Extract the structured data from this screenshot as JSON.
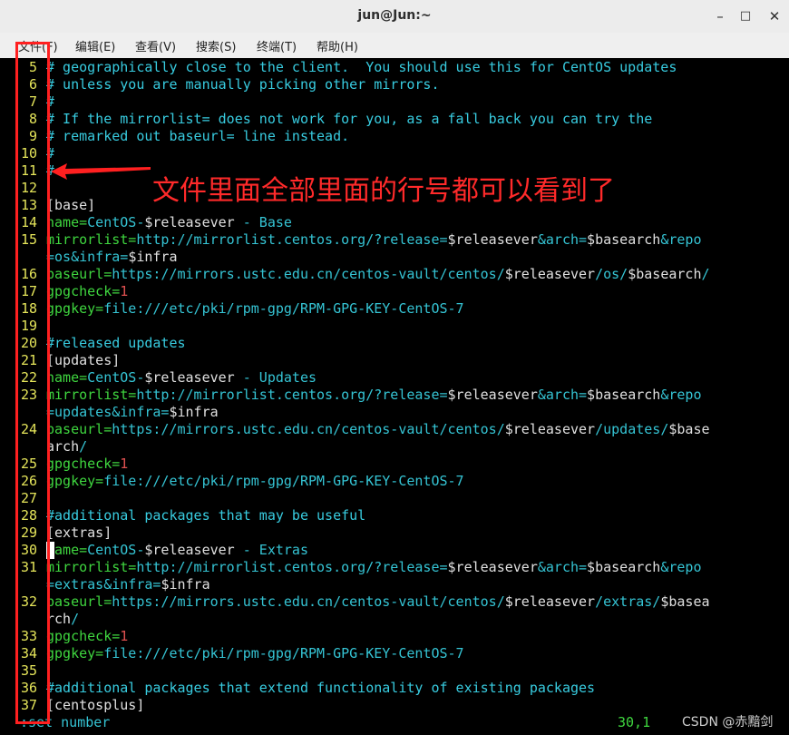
{
  "window": {
    "title": "jun@Jun:~",
    "minimize": "–",
    "maximize": "□",
    "close": "✕"
  },
  "menu": [
    "文件(F)",
    "编辑(E)",
    "查看(V)",
    "搜索(S)",
    "终端(T)",
    "帮助(H)"
  ],
  "lines": [
    {
      "n": "5",
      "parts": [
        [
          "c-com",
          "# geographically close to the client.  You should use this for CentOS updates"
        ]
      ]
    },
    {
      "n": "6",
      "parts": [
        [
          "c-com",
          "# unless you are manually picking other mirrors."
        ]
      ]
    },
    {
      "n": "7",
      "parts": [
        [
          "c-com",
          "#"
        ]
      ]
    },
    {
      "n": "8",
      "parts": [
        [
          "c-com",
          "# If the mirrorlist= does not work for you, as a fall back you can try the"
        ]
      ]
    },
    {
      "n": "9",
      "parts": [
        [
          "c-com",
          "# remarked out baseurl= line instead."
        ]
      ]
    },
    {
      "n": "10",
      "parts": [
        [
          "c-com",
          "#"
        ]
      ]
    },
    {
      "n": "11",
      "parts": [
        [
          "c-com",
          "#"
        ]
      ]
    },
    {
      "n": "12",
      "parts": []
    },
    {
      "n": "13",
      "parts": [
        [
          "c-br",
          "[base]"
        ]
      ]
    },
    {
      "n": "14",
      "parts": [
        [
          "c-key",
          "name="
        ],
        [
          "c-val",
          "CentOS-"
        ],
        [
          "c-var",
          "$releasever"
        ],
        [
          "c-val",
          " - Base"
        ]
      ]
    },
    {
      "n": "15",
      "parts": [
        [
          "c-key",
          "mirrorlist="
        ],
        [
          "c-val",
          "http://mirrorlist.centos.org/?release="
        ],
        [
          "c-var",
          "$releasever"
        ],
        [
          "c-val",
          "&arch="
        ],
        [
          "c-var",
          "$basearch"
        ],
        [
          "c-val",
          "&repo"
        ]
      ]
    },
    {
      "n": "",
      "parts": [
        [
          "c-val",
          "=os&infra="
        ],
        [
          "c-var",
          "$infra"
        ]
      ]
    },
    {
      "n": "16",
      "parts": [
        [
          "c-key",
          "baseurl="
        ],
        [
          "c-val",
          "https://mirrors.ustc.edu.cn/centos-vault/centos/"
        ],
        [
          "c-var",
          "$releasever"
        ],
        [
          "c-val",
          "/os/"
        ],
        [
          "c-var",
          "$basearch"
        ],
        [
          "c-val",
          "/"
        ]
      ]
    },
    {
      "n": "17",
      "parts": [
        [
          "c-key",
          "gpgcheck="
        ],
        [
          "c-num",
          "1"
        ]
      ]
    },
    {
      "n": "18",
      "parts": [
        [
          "c-key",
          "gpgkey="
        ],
        [
          "c-val",
          "file:///etc/pki/rpm-gpg/RPM-GPG-KEY-CentOS-7"
        ]
      ]
    },
    {
      "n": "19",
      "parts": []
    },
    {
      "n": "20",
      "parts": [
        [
          "c-com",
          "#released updates"
        ]
      ]
    },
    {
      "n": "21",
      "parts": [
        [
          "c-br",
          "[updates]"
        ]
      ]
    },
    {
      "n": "22",
      "parts": [
        [
          "c-key",
          "name="
        ],
        [
          "c-val",
          "CentOS-"
        ],
        [
          "c-var",
          "$releasever"
        ],
        [
          "c-val",
          " - Updates"
        ]
      ]
    },
    {
      "n": "23",
      "parts": [
        [
          "c-key",
          "mirrorlist="
        ],
        [
          "c-val",
          "http://mirrorlist.centos.org/?release="
        ],
        [
          "c-var",
          "$releasever"
        ],
        [
          "c-val",
          "&arch="
        ],
        [
          "c-var",
          "$basearch"
        ],
        [
          "c-val",
          "&repo"
        ]
      ]
    },
    {
      "n": "",
      "parts": [
        [
          "c-val",
          "=updates&infra="
        ],
        [
          "c-var",
          "$infra"
        ]
      ]
    },
    {
      "n": "24",
      "parts": [
        [
          "c-key",
          "baseurl="
        ],
        [
          "c-val",
          "https://mirrors.ustc.edu.cn/centos-vault/centos/"
        ],
        [
          "c-var",
          "$releasever"
        ],
        [
          "c-val",
          "/updates/"
        ],
        [
          "c-var",
          "$base"
        ]
      ]
    },
    {
      "n": "",
      "parts": [
        [
          "c-var",
          "arch"
        ],
        [
          "c-val",
          "/"
        ]
      ]
    },
    {
      "n": "25",
      "parts": [
        [
          "c-key",
          "gpgcheck="
        ],
        [
          "c-num",
          "1"
        ]
      ]
    },
    {
      "n": "26",
      "parts": [
        [
          "c-key",
          "gpgkey="
        ],
        [
          "c-val",
          "file:///etc/pki/rpm-gpg/RPM-GPG-KEY-CentOS-7"
        ]
      ]
    },
    {
      "n": "27",
      "parts": []
    },
    {
      "n": "28",
      "parts": [
        [
          "c-com",
          "#additional packages that may be useful"
        ]
      ]
    },
    {
      "n": "29",
      "parts": [
        [
          "c-br",
          "[extras]"
        ]
      ]
    },
    {
      "n": "30",
      "parts": [
        [
          "c-key",
          "name="
        ],
        [
          "c-val",
          "CentOS-"
        ],
        [
          "c-var",
          "$releasever"
        ],
        [
          "c-val",
          " - Extras"
        ]
      ]
    },
    {
      "n": "31",
      "parts": [
        [
          "c-key",
          "mirrorlist="
        ],
        [
          "c-val",
          "http://mirrorlist.centos.org/?release="
        ],
        [
          "c-var",
          "$releasever"
        ],
        [
          "c-val",
          "&arch="
        ],
        [
          "c-var",
          "$basearch"
        ],
        [
          "c-val",
          "&repo"
        ]
      ]
    },
    {
      "n": "",
      "parts": [
        [
          "c-val",
          "=extras&infra="
        ],
        [
          "c-var",
          "$infra"
        ]
      ]
    },
    {
      "n": "32",
      "parts": [
        [
          "c-key",
          "baseurl="
        ],
        [
          "c-val",
          "https://mirrors.ustc.edu.cn/centos-vault/centos/"
        ],
        [
          "c-var",
          "$releasever"
        ],
        [
          "c-val",
          "/extras/"
        ],
        [
          "c-var",
          "$basea"
        ]
      ]
    },
    {
      "n": "",
      "parts": [
        [
          "c-var",
          "rch"
        ],
        [
          "c-val",
          "/"
        ]
      ]
    },
    {
      "n": "33",
      "parts": [
        [
          "c-key",
          "gpgcheck="
        ],
        [
          "c-num",
          "1"
        ]
      ]
    },
    {
      "n": "34",
      "parts": [
        [
          "c-key",
          "gpgkey="
        ],
        [
          "c-val",
          "file:///etc/pki/rpm-gpg/RPM-GPG-KEY-CentOS-7"
        ]
      ]
    },
    {
      "n": "35",
      "parts": []
    },
    {
      "n": "36",
      "parts": [
        [
          "c-com",
          "#additional packages that extend functionality of existing packages"
        ]
      ]
    },
    {
      "n": "37",
      "parts": [
        [
          "c-br",
          "[centosplus]"
        ]
      ]
    }
  ],
  "status": {
    "command": ":set number",
    "position": "30,1"
  },
  "annotation": "文件里面全部里面的行号都可以看到了",
  "watermark": "CSDN @赤黯剑",
  "colors": {
    "annotation": "#ff2a2a",
    "line_number": "#e5e55a",
    "comment": "#38cce0",
    "key": "#3fd63f"
  }
}
